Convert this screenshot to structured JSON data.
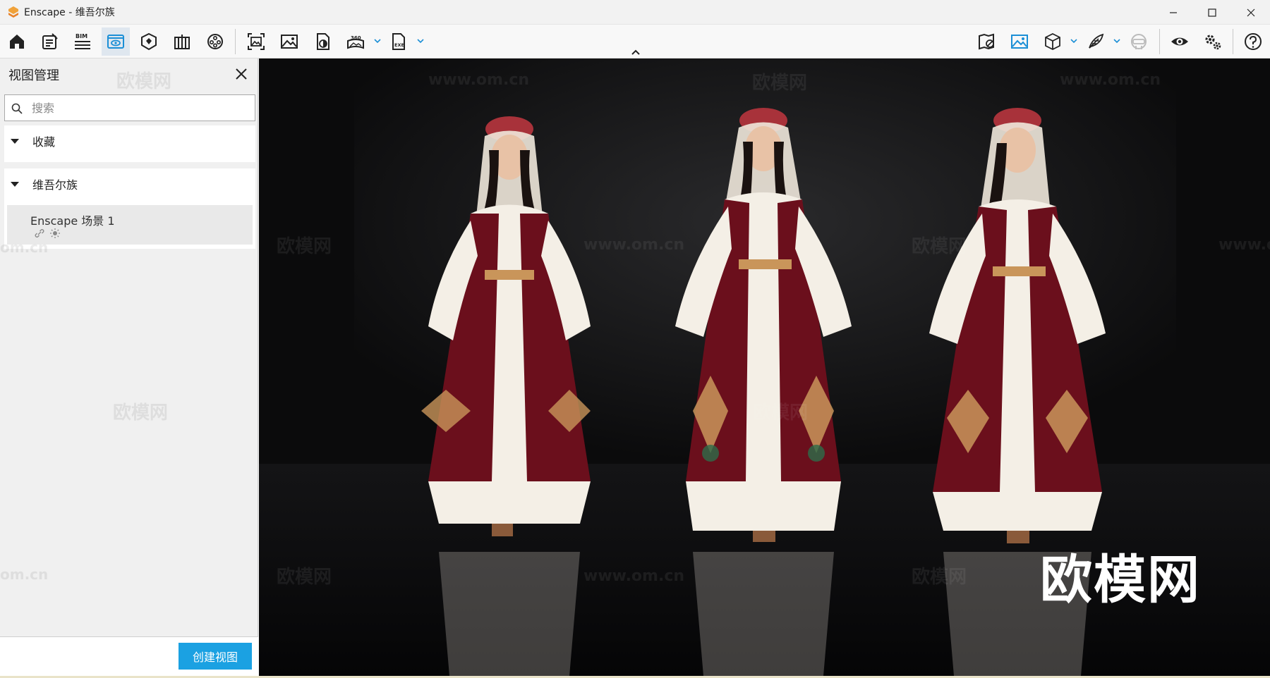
{
  "window": {
    "title": "Enscape - 维吾尔族",
    "controls": [
      "minimize-icon",
      "maximize-icon",
      "close-icon"
    ]
  },
  "toolbar": {
    "left_icons": [
      "home-icon",
      "notes-icon",
      "bim-icon",
      "views-icon",
      "asset-library-icon",
      "material-editor-icon",
      "video-editor-icon",
      "capture-view-icon",
      "image-icon",
      "batch-render-icon",
      "panorama-360-icon",
      "exe-export-icon"
    ],
    "bim_label": "BIM",
    "pano_label": "360",
    "exe_label": "EXE",
    "right_icons": [
      "map-icon",
      "visual-settings-icon",
      "cube-icon",
      "feather-icon",
      "vr-headset-icon",
      "eye-icon",
      "settings-icon",
      "help-icon"
    ],
    "active": "views-icon"
  },
  "sidebar": {
    "title": "视图管理",
    "search_placeholder": "搜索",
    "sections": [
      {
        "label": "收藏",
        "items": []
      },
      {
        "label": "维吾尔族",
        "items": [
          {
            "name": "Enscape 场景 1",
            "icons": [
              "link-icon",
              "sun-icon"
            ]
          }
        ]
      }
    ],
    "create_button": "创建视图"
  },
  "viewport": {
    "watermark_small": "欧模网",
    "watermark_url": "www.om.cn",
    "watermark_big": "欧模网",
    "sidebar_watermark_small": "欧模网",
    "sidebar_watermark_url": "om.cn"
  },
  "colors": {
    "accent": "#1ba1e2",
    "active_tool": "#dfe7ef",
    "viewport_bg": "#0b0b0c",
    "dress_red": "#6b0f1c",
    "dress_white": "#f4efe6",
    "gold_trim": "#c9955a"
  }
}
